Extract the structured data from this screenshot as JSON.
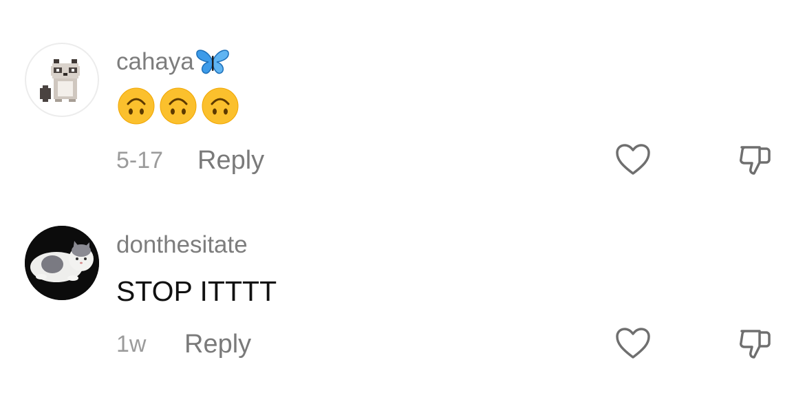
{
  "comments": [
    {
      "username": "cahaya",
      "username_decoration_icon": "blue-butterfly-icon",
      "content_emojis": [
        "upside-down-face-emoji",
        "upside-down-face-emoji",
        "upside-down-face-emoji"
      ],
      "timestamp": "5-17",
      "reply_label": "Reply",
      "avatar_icon": "pixel-raccoon-avatar",
      "like_icon": "heart-outline-icon",
      "dislike_icon": "thumbs-down-outline-icon"
    },
    {
      "username": "donthesitate",
      "text": "STOP ITTTT",
      "timestamp": "1w",
      "reply_label": "Reply",
      "avatar_icon": "cat-photo-avatar",
      "like_icon": "heart-outline-icon",
      "dislike_icon": "thumbs-down-outline-icon"
    }
  ],
  "colors": {
    "username": "#7d7d7d",
    "timestamp": "#9b9b9b",
    "reply": "#7a7a7a",
    "comment_text": "#111111",
    "icon_stroke": "#6f6f6f",
    "butterfly": "#3d9be9",
    "emoji_face": "#fbc02d"
  }
}
